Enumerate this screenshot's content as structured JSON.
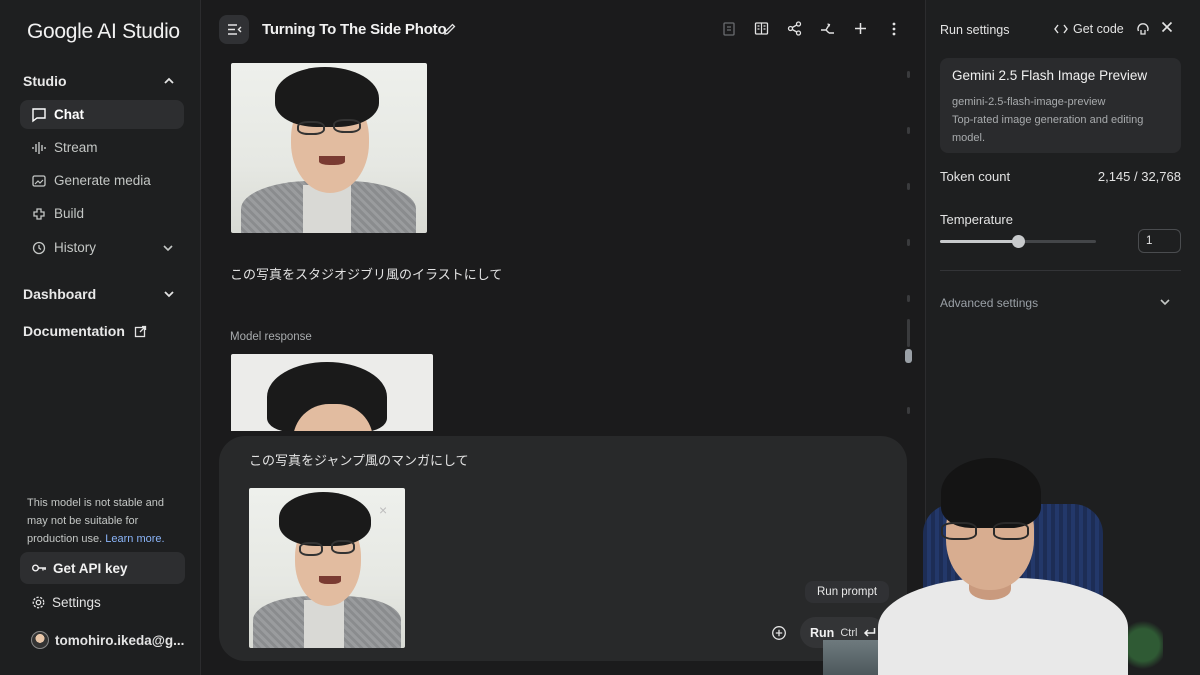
{
  "app": {
    "logo": "Google AI Studio"
  },
  "sidebar": {
    "studio_label": "Studio",
    "items": [
      {
        "label": "Chat",
        "icon": "chat-icon",
        "active": true
      },
      {
        "label": "Stream",
        "icon": "stream-icon"
      },
      {
        "label": "Generate media",
        "icon": "media-icon"
      },
      {
        "label": "Build",
        "icon": "build-icon"
      },
      {
        "label": "History",
        "icon": "history-icon"
      }
    ],
    "dashboard_label": "Dashboard",
    "documentation_label": "Documentation",
    "warning_text": "This model is not stable and may not be suitable for production use.",
    "warning_link": "Learn more.",
    "get_api_key": "Get API key",
    "settings": "Settings",
    "user": "tomohiro.ikeda@g..."
  },
  "header": {
    "title": "Turning To The Side Photo"
  },
  "chat": {
    "user_message": "この写真をスタジオジブリ風のイラストにして",
    "model_response_label": "Model response"
  },
  "prompt": {
    "text": "この写真をジャンプ風のマンガにして",
    "remove_symbol": "×",
    "tooltip": "Run prompt",
    "run_label": "Run",
    "run_shortcut": "Ctrl"
  },
  "run_settings": {
    "title": "Run settings",
    "get_code": "Get code",
    "model": {
      "name": "Gemini 2.5 Flash Image Preview",
      "id": "gemini-2.5-flash-image-preview",
      "description": "Top-rated image generation and editing model."
    },
    "token_count_label": "Token count",
    "token_count_value": "2,145 / 32,768",
    "temperature_label": "Temperature",
    "temperature_value": "1",
    "temperature_fraction": 0.5,
    "advanced_settings": "Advanced settings"
  },
  "colors": {
    "background": "#1b1b1c",
    "panel": "#1e1f20",
    "link": "#8ab4f8"
  }
}
